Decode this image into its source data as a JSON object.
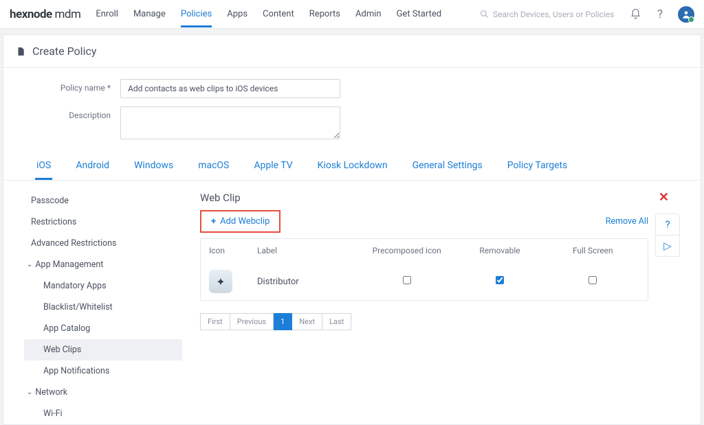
{
  "brand": {
    "a": "hexnode",
    "b": " mdm"
  },
  "topnav": [
    "Enroll",
    "Manage",
    "Policies",
    "Apps",
    "Content",
    "Reports",
    "Admin",
    "Get Started"
  ],
  "topnav_active": 2,
  "search_placeholder": "Search Devices, Users or Policies",
  "page_title": "Create Policy",
  "form": {
    "policy_name_label": "Policy name *",
    "policy_name_value": "Add contacts as web clips to iOS devices",
    "description_label": "Description",
    "description_value": ""
  },
  "platform_tabs": [
    "iOS",
    "Android",
    "Windows",
    "macOS",
    "Apple TV",
    "Kiosk Lockdown",
    "General Settings",
    "Policy Targets"
  ],
  "platform_active": 0,
  "sidebar": {
    "items_top": [
      "Passcode",
      "Restrictions",
      "Advanced Restrictions"
    ],
    "group1": {
      "label": "App Management",
      "children": [
        "Mandatory Apps",
        "Blacklist/Whitelist",
        "App Catalog",
        "Web Clips",
        "App Notifications"
      ],
      "active": 3
    },
    "group2": {
      "label": "Network",
      "children": [
        "Wi-Fi"
      ]
    }
  },
  "panel": {
    "title": "Web Clip",
    "add_label": "Add Webclip",
    "remove_all": "Remove All",
    "columns": [
      "Icon",
      "Label",
      "Precomposed icon",
      "Removable",
      "Full Screen"
    ],
    "row": {
      "label": "Distributor",
      "precomposed": false,
      "removable": true,
      "fullscreen": false
    }
  },
  "pager": [
    "First",
    "Previous",
    "1",
    "Next",
    "Last"
  ],
  "pager_active": 2
}
